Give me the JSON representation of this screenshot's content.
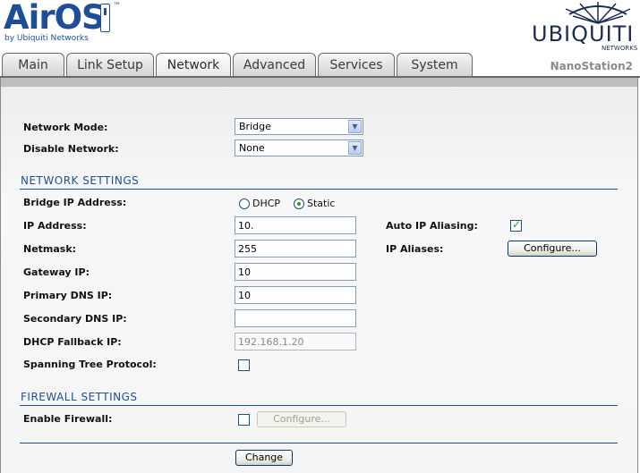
{
  "header": {
    "logo_text": "AirOS",
    "logo_tm": "™",
    "logo_by": "by Ubiquiti Networks",
    "brand": "UBIQUITI",
    "brand_sub": "NETWORKS",
    "device_name": "NanoStation2"
  },
  "tabs": [
    {
      "label": "Main"
    },
    {
      "label": "Link Setup"
    },
    {
      "label": "Network",
      "active": true
    },
    {
      "label": "Advanced"
    },
    {
      "label": "Services"
    },
    {
      "label": "System"
    }
  ],
  "form": {
    "network_mode": {
      "label": "Network Mode:",
      "value": "Bridge"
    },
    "disable_network": {
      "label": "Disable Network:",
      "value": "None"
    },
    "network_settings_title": "NETWORK SETTINGS",
    "bridge_ip": {
      "label": "Bridge IP Address:",
      "option_dhcp": "DHCP",
      "option_static": "Static",
      "selected": "Static"
    },
    "ip_address": {
      "label": "IP Address:",
      "value": "10."
    },
    "netmask": {
      "label": "Netmask:",
      "value": "255"
    },
    "gateway": {
      "label": "Gateway IP:",
      "value": "10"
    },
    "primary_dns": {
      "label": "Primary DNS IP:",
      "value": "10"
    },
    "secondary_dns": {
      "label": "Secondary DNS IP:",
      "value": ""
    },
    "dhcp_fallback": {
      "label": "DHCP Fallback IP:",
      "value": "192.168.1.20"
    },
    "stp": {
      "label": "Spanning Tree Protocol:",
      "checked": false
    },
    "auto_ip_aliasing": {
      "label": "Auto IP Aliasing:",
      "checked": true
    },
    "ip_aliases": {
      "label": "IP Aliases:",
      "button": "Configure..."
    },
    "firewall_settings_title": "FIREWALL SETTINGS",
    "enable_firewall": {
      "label": "Enable Firewall:",
      "checked": false,
      "button": "Configure..."
    },
    "change_button": "Change"
  },
  "colors": {
    "accent": "#1f4e99",
    "check": "#21a121"
  }
}
